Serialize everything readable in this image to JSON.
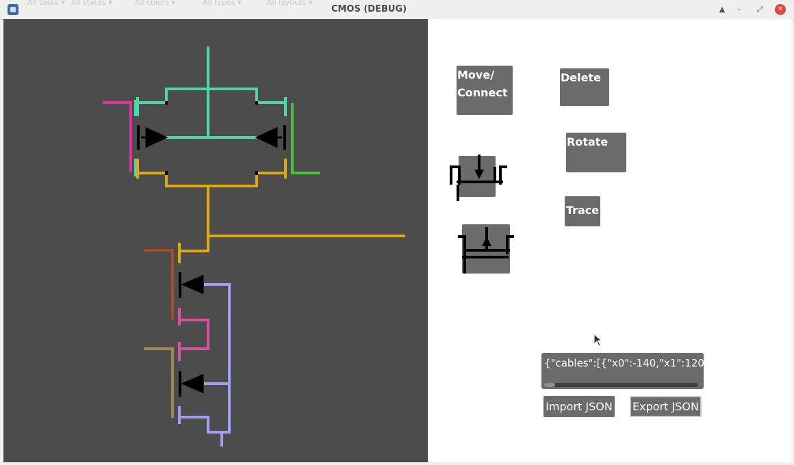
{
  "window": {
    "title": "CMOS (DEBUG)",
    "ghost_menu": [
      "All tasks ▾",
      "All states ▾",
      "All colors ▾",
      "All types ▾",
      "All layouts ▾"
    ]
  },
  "toolbar": {
    "move_connect_line1": "Move/",
    "move_connect_line2": "Connect",
    "delete_label": "Delete",
    "rotate_label": "Rotate",
    "trace_label": "Trace"
  },
  "components": {
    "nmos_icon": "nmos-transistor-icon",
    "pmos_icon": "pmos-transistor-icon"
  },
  "json_io": {
    "value": "{\"cables\":[{\"x0\":-140,\"x1\":120,",
    "import_label": "Import JSON",
    "export_label": "Export JSON"
  },
  "colors": {
    "canvas_bg": "#4c4c4c",
    "button_bg": "#6b6b6b",
    "wire_teal": "#4fd6a3",
    "wire_gold": "#e0aa0f",
    "wire_magenta": "#e0309a",
    "wire_green": "#46c23c",
    "wire_rust": "#a84a30",
    "wire_pink": "#d9519f",
    "wire_lavender": "#9f9ef2",
    "wire_tan": "#a8874e",
    "transistor_body": "#000000",
    "close_button": "#e0463c"
  }
}
